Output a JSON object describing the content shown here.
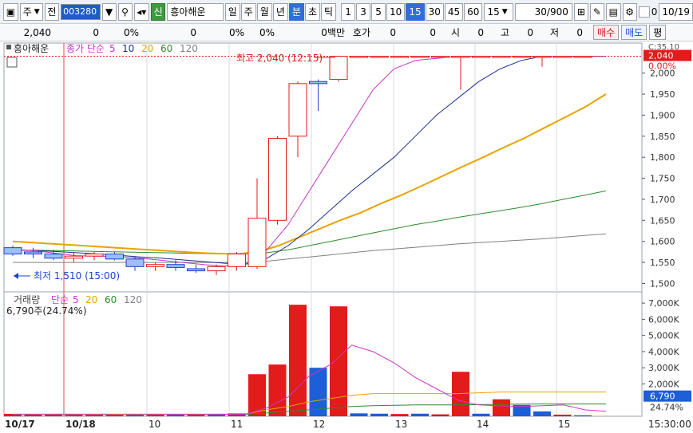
{
  "toolbar": {
    "market_label": "주",
    "prev_label": "전",
    "stock_code": "003280",
    "stock_badge": "신",
    "stock_name": "흥아해운",
    "periods": [
      "일",
      "주",
      "월",
      "년",
      "분",
      "초",
      "틱"
    ],
    "active_period": "분",
    "intervals": [
      "1",
      "3",
      "5",
      "10",
      "15",
      "30",
      "45",
      "60"
    ],
    "active_interval": "15",
    "interval_select": "15",
    "ratio": "30/900",
    "date": "10/19",
    "checkbox_label": "0"
  },
  "quote": {
    "price": "2,040",
    "change": "0",
    "change_pct": "0%",
    "volume": "0",
    "vol_pct": "0%",
    "other_pct": "0%",
    "unit": "0백만",
    "hoga_label": "호가",
    "hoga_value1": "0",
    "hoga_value2": "0",
    "open_label": "시",
    "open_value": "0",
    "high_label": "고",
    "high_value": "0",
    "low_label": "저",
    "low_value": "0",
    "buy_button": "매수",
    "sell_button": "매도",
    "eval_button": "평"
  },
  "price_panel": {
    "stock_name": "흥아해운",
    "ma_label": "종가 단순",
    "ma_periods": [
      "5",
      "10",
      "20",
      "60",
      "120"
    ],
    "ma_colors": [
      "#c837c8",
      "#1c2f8f",
      "#e6a400",
      "#2e8b2e",
      "#808080"
    ],
    "high_annotation": "최고 2,040 (12:15)",
    "low_annotation": "최저 1,510 (15:00)",
    "current_price_tag": "2,040",
    "current_pct_tag": "0.00%",
    "top_label": "C:35.10",
    "price_ticks": [
      "2,000",
      "1,950",
      "1,900",
      "1,850",
      "1,800",
      "1,750",
      "1,700",
      "1,650",
      "1,600",
      "1,550",
      "1,500"
    ]
  },
  "volume_panel": {
    "label": "거래량",
    "ma_label": "단순",
    "ma_periods": [
      "5",
      "20",
      "60",
      "120"
    ],
    "current_volume": "6,790주(24.74%)",
    "volume_tag": "6,790",
    "pct_tag": "24.74%",
    "volume_ticks": [
      "7,000K",
      "6,000K",
      "5,000K",
      "4,000K",
      "3,000K",
      "2,000K"
    ]
  },
  "time_axis": {
    "labels": [
      "10/17",
      "10/18",
      "10",
      "11",
      "12",
      "13",
      "14",
      "15"
    ],
    "current_time": "15:30:00"
  },
  "chart_data": {
    "type": "candlestick",
    "price_range": [
      1480,
      2060
    ],
    "volume_range": [
      0,
      7500
    ],
    "candles": [
      {
        "o": 1585,
        "h": 1590,
        "l": 1565,
        "c": 1570,
        "v": 150
      },
      {
        "o": 1575,
        "h": 1585,
        "l": 1560,
        "c": 1570,
        "v": 120
      },
      {
        "o": 1570,
        "h": 1580,
        "l": 1555,
        "c": 1560,
        "v": 100
      },
      {
        "o": 1560,
        "h": 1575,
        "l": 1550,
        "c": 1565,
        "v": 90
      },
      {
        "o": 1565,
        "h": 1575,
        "l": 1555,
        "c": 1570,
        "v": 90
      },
      {
        "o": 1570,
        "h": 1575,
        "l": 1555,
        "c": 1558,
        "v": 110
      },
      {
        "o": 1558,
        "h": 1565,
        "l": 1530,
        "c": 1540,
        "v": 140
      },
      {
        "o": 1540,
        "h": 1550,
        "l": 1530,
        "c": 1545,
        "v": 100
      },
      {
        "o": 1545,
        "h": 1555,
        "l": 1530,
        "c": 1538,
        "v": 110
      },
      {
        "o": 1535,
        "h": 1545,
        "l": 1525,
        "c": 1530,
        "v": 130
      },
      {
        "o": 1530,
        "h": 1545,
        "l": 1520,
        "c": 1540,
        "v": 110
      },
      {
        "o": 1540,
        "h": 1575,
        "l": 1530,
        "c": 1570,
        "v": 180
      },
      {
        "o": 1540,
        "h": 1750,
        "l": 1535,
        "c": 1655,
        "v": 2600
      },
      {
        "o": 1650,
        "h": 1850,
        "l": 1640,
        "c": 1845,
        "v": 3200
      },
      {
        "o": 1850,
        "h": 1980,
        "l": 1800,
        "c": 1975,
        "v": 6900
      },
      {
        "o": 1980,
        "h": 1985,
        "l": 1910,
        "c": 1975,
        "v": 3000
      },
      {
        "o": 1985,
        "h": 2040,
        "l": 1980,
        "c": 2040,
        "v": 6800
      },
      {
        "o": 2040,
        "h": 2040,
        "l": 2040,
        "c": 2040,
        "v": 180
      },
      {
        "o": 2040,
        "h": 2040,
        "l": 2040,
        "c": 2040,
        "v": 160
      },
      {
        "o": 2040,
        "h": 2040,
        "l": 2040,
        "c": 2040,
        "v": 140
      },
      {
        "o": 2040,
        "h": 2040,
        "l": 2040,
        "c": 2040,
        "v": 160
      },
      {
        "o": 2040,
        "h": 2040,
        "l": 2040,
        "c": 2040,
        "v": 120
      },
      {
        "o": 2040,
        "h": 2040,
        "l": 1960,
        "c": 2040,
        "v": 2750
      },
      {
        "o": 2040,
        "h": 2040,
        "l": 2040,
        "c": 2040,
        "v": 160
      },
      {
        "o": 2040,
        "h": 2040,
        "l": 2040,
        "c": 2040,
        "v": 1050
      },
      {
        "o": 2040,
        "h": 2040,
        "l": 2040,
        "c": 2040,
        "v": 700
      },
      {
        "o": 2040,
        "h": 2040,
        "l": 2015,
        "c": 2040,
        "v": 300
      },
      {
        "o": 2040,
        "h": 2040,
        "l": 2040,
        "c": 2040,
        "v": 100
      },
      {
        "o": 2040,
        "h": 2040,
        "l": 2040,
        "c": 2040,
        "v": 60
      }
    ],
    "volume_colors": [
      "red",
      "red",
      "red",
      "red",
      "red",
      "red",
      "blue",
      "red",
      "blue",
      "red",
      "blue",
      "red",
      "red",
      "red",
      "red",
      "blue",
      "red",
      "blue",
      "blue",
      "red",
      "blue",
      "red",
      "red",
      "blue",
      "red",
      "blue",
      "blue",
      "red",
      "blue"
    ],
    "ma5": [
      1580,
      1578,
      1572,
      1566,
      1565,
      1564,
      1560,
      1555,
      1550,
      1545,
      1541,
      1548,
      1580,
      1640,
      1720,
      1800,
      1880,
      1960,
      2010,
      2030,
      2035,
      2040,
      2040,
      2040,
      2040,
      2040,
      2040,
      2040,
      2040
    ],
    "ma10": [
      1580,
      1578,
      1576,
      1573,
      1570,
      1567,
      1563,
      1560,
      1556,
      1552,
      1548,
      1546,
      1560,
      1590,
      1630,
      1675,
      1720,
      1760,
      1800,
      1850,
      1900,
      1940,
      1980,
      2010,
      2030,
      2040,
      2040,
      2040,
      2040
    ],
    "ma20": [
      1600,
      1597,
      1594,
      1591,
      1588,
      1585,
      1582,
      1579,
      1576,
      1573,
      1571,
      1570,
      1575,
      1590,
      1610,
      1630,
      1650,
      1668,
      1690,
      1710,
      1732,
      1755,
      1778,
      1800,
      1823,
      1845,
      1870,
      1895,
      1920,
      1950
    ],
    "ma60": [
      1580,
      1579,
      1578,
      1577,
      1576,
      1575,
      1574,
      1573,
      1572,
      1571,
      1570,
      1570,
      1573,
      1580,
      1590,
      1600,
      1610,
      1620,
      1630,
      1640,
      1648,
      1657,
      1665,
      1673,
      1681,
      1690,
      1700,
      1710,
      1720
    ],
    "ma120": [
      1550,
      1550,
      1550,
      1550,
      1550,
      1550,
      1550,
      1550,
      1550,
      1550,
      1550,
      1550,
      1553,
      1558,
      1563,
      1568,
      1573,
      1578,
      1582,
      1586,
      1590,
      1594,
      1597,
      1600,
      1603,
      1606,
      1610,
      1614,
      1618
    ],
    "vol_ma5": [
      120,
      115,
      110,
      108,
      105,
      100,
      105,
      110,
      115,
      115,
      120,
      130,
      520,
      1200,
      2500,
      3200,
      4400,
      4000,
      3300,
      2400,
      1700,
      1000,
      700,
      640,
      600,
      650,
      700,
      400,
      300
    ],
    "vol_ma20": [
      140,
      140,
      140,
      140,
      140,
      140,
      140,
      140,
      140,
      140,
      140,
      140,
      400,
      600,
      900,
      1100,
      1300,
      1400,
      1400,
      1400,
      1400,
      1400,
      1450,
      1500,
      1500,
      1500,
      1500,
      1500,
      1500
    ],
    "vol_ma60": [
      120,
      120,
      120,
      120,
      120,
      120,
      120,
      120,
      120,
      120,
      120,
      120,
      200,
      300,
      400,
      500,
      600,
      650,
      680,
      700,
      700,
      700,
      720,
      740,
      750,
      760,
      760,
      760,
      760
    ]
  }
}
